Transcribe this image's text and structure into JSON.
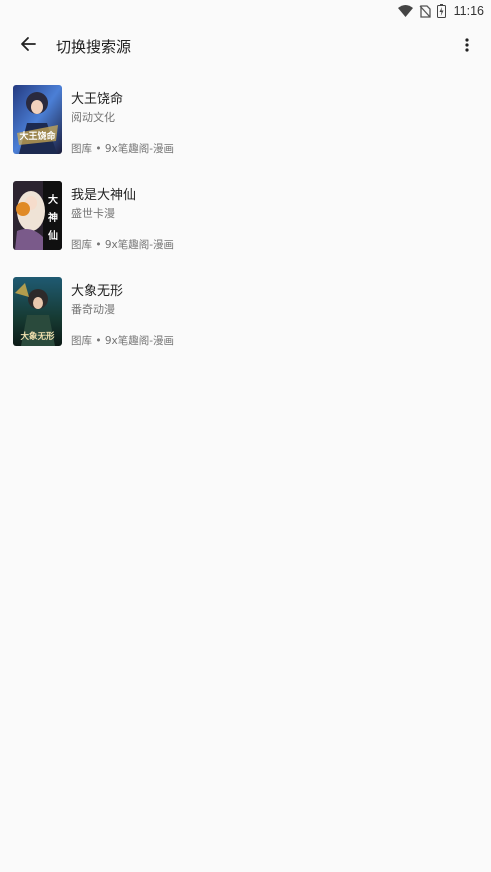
{
  "status_bar": {
    "time": "11:16",
    "icons": [
      "wifi-icon",
      "no-sim-icon",
      "battery-charging-icon"
    ]
  },
  "toolbar": {
    "back_icon": "arrow-back-icon",
    "title": "切换搜索源",
    "more_icon": "more-vert-icon"
  },
  "sources": [
    {
      "title": "大王饶命",
      "author": "阅动文化",
      "source": "图库 • 9x笔趣阁-漫画",
      "cover_overlay": "大王饶命",
      "cover_colors": [
        "#1d2a5a",
        "#3a63c9",
        "#c9a24a"
      ]
    },
    {
      "title": "我是大神仙",
      "author": "盛世卡漫",
      "source": "图库 • 9x笔趣阁-漫画",
      "cover_overlay": "大神仙",
      "cover_colors": [
        "#2b1f2a",
        "#e9d9c8",
        "#d98a2b"
      ]
    },
    {
      "title": "大象无形",
      "author": "番奇动漫",
      "source": "图库 • 9x笔趣阁-漫画",
      "cover_overlay": "大象无形",
      "cover_colors": [
        "#0f2430",
        "#2f6e6a",
        "#d8b04a"
      ]
    }
  ]
}
